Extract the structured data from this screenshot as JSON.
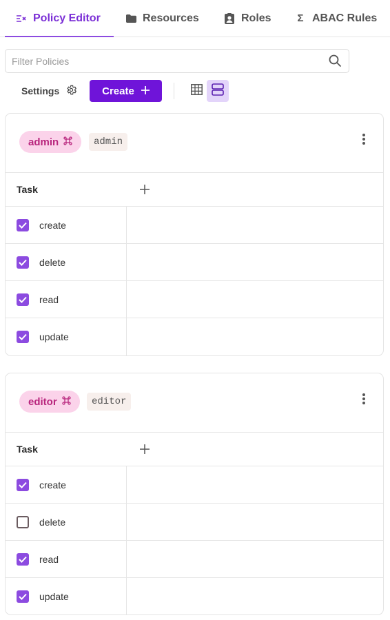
{
  "tabs": [
    {
      "label": "Policy Editor",
      "icon": "policy-icon",
      "active": true
    },
    {
      "label": "Resources",
      "icon": "folder-icon",
      "active": false
    },
    {
      "label": "Roles",
      "icon": "badge-icon",
      "active": false
    },
    {
      "label": "ABAC Rules",
      "icon": "sigma-icon",
      "active": false
    }
  ],
  "filter": {
    "placeholder": "Filter Policies",
    "value": ""
  },
  "toolbar": {
    "settings_label": "Settings",
    "create_label": "Create"
  },
  "colors": {
    "accent": "#6f14d9",
    "tab_active": "#7b2fd6",
    "pill_bg": "#fbd3ea",
    "pill_text": "#b8257d",
    "checkbox": "#8c4be0"
  },
  "roles": [
    {
      "name": "admin",
      "key": "admin",
      "column_header": "Task",
      "permissions": [
        {
          "label": "create",
          "checked": true
        },
        {
          "label": "delete",
          "checked": true
        },
        {
          "label": "read",
          "checked": true
        },
        {
          "label": "update",
          "checked": true
        }
      ]
    },
    {
      "name": "editor",
      "key": "editor",
      "column_header": "Task",
      "permissions": [
        {
          "label": "create",
          "checked": true
        },
        {
          "label": "delete",
          "checked": false
        },
        {
          "label": "read",
          "checked": true
        },
        {
          "label": "update",
          "checked": true
        }
      ]
    }
  ]
}
